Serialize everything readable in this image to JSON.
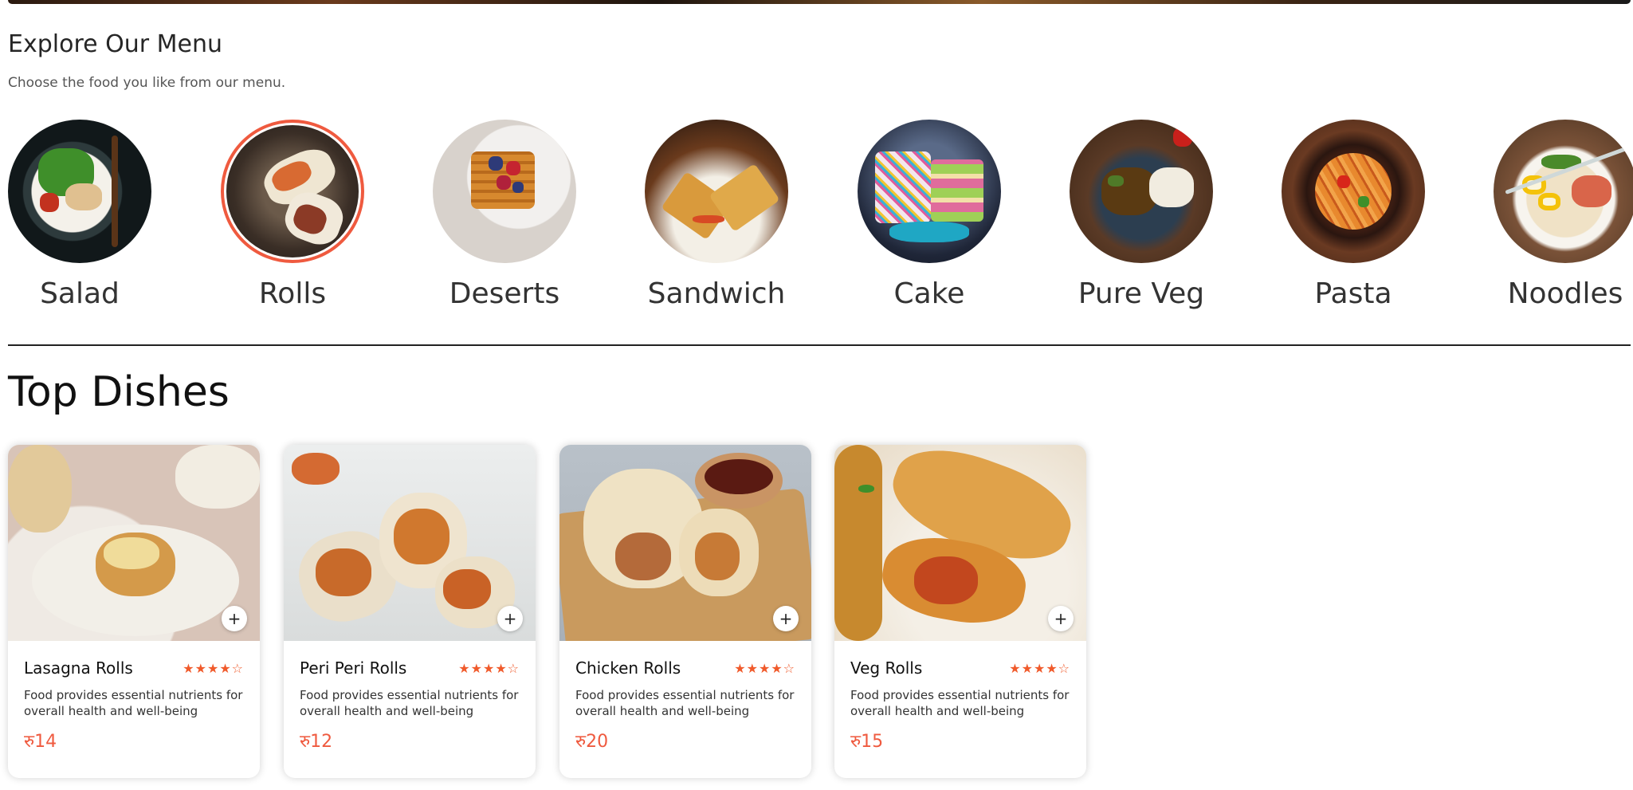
{
  "explore": {
    "title": "Explore Our Menu",
    "subtitle": "Choose the food you like from our menu."
  },
  "menu": [
    {
      "label": "Salad",
      "active": false,
      "icon": "salad-bowl-image"
    },
    {
      "label": "Rolls",
      "active": true,
      "icon": "rolls-image"
    },
    {
      "label": "Deserts",
      "active": false,
      "icon": "waffle-dessert-image"
    },
    {
      "label": "Sandwich",
      "active": false,
      "icon": "sandwich-image"
    },
    {
      "label": "Cake",
      "active": false,
      "icon": "cake-image"
    },
    {
      "label": "Pure Veg",
      "active": false,
      "icon": "veg-curry-image"
    },
    {
      "label": "Pasta",
      "active": false,
      "icon": "pasta-image"
    },
    {
      "label": "Noodles",
      "active": false,
      "icon": "noodles-bowl-image"
    }
  ],
  "top_dishes": {
    "title": "Top Dishes",
    "items": [
      {
        "name": "Lasagna Rolls",
        "stars": "★★★★☆",
        "rating": 4,
        "description": "Food provides essential nutrients for overall health and well-being",
        "price": "रु14",
        "add_label": "+"
      },
      {
        "name": "Peri Peri Rolls",
        "stars": "★★★★☆",
        "rating": 4,
        "description": "Food provides essential nutrients for overall health and well-being",
        "price": "रु12",
        "add_label": "+"
      },
      {
        "name": "Chicken Rolls",
        "stars": "★★★★☆",
        "rating": 4,
        "description": "Food provides essential nutrients for overall health and well-being",
        "price": "रु20",
        "add_label": "+"
      },
      {
        "name": "Veg Rolls",
        "stars": "★★★★☆",
        "rating": 4,
        "description": "Food provides essential nutrients for overall health and well-being",
        "price": "रु15",
        "add_label": "+"
      }
    ]
  },
  "colors": {
    "accent": "#ef5a3f",
    "star": "#f05a2b",
    "text": "#262626"
  }
}
